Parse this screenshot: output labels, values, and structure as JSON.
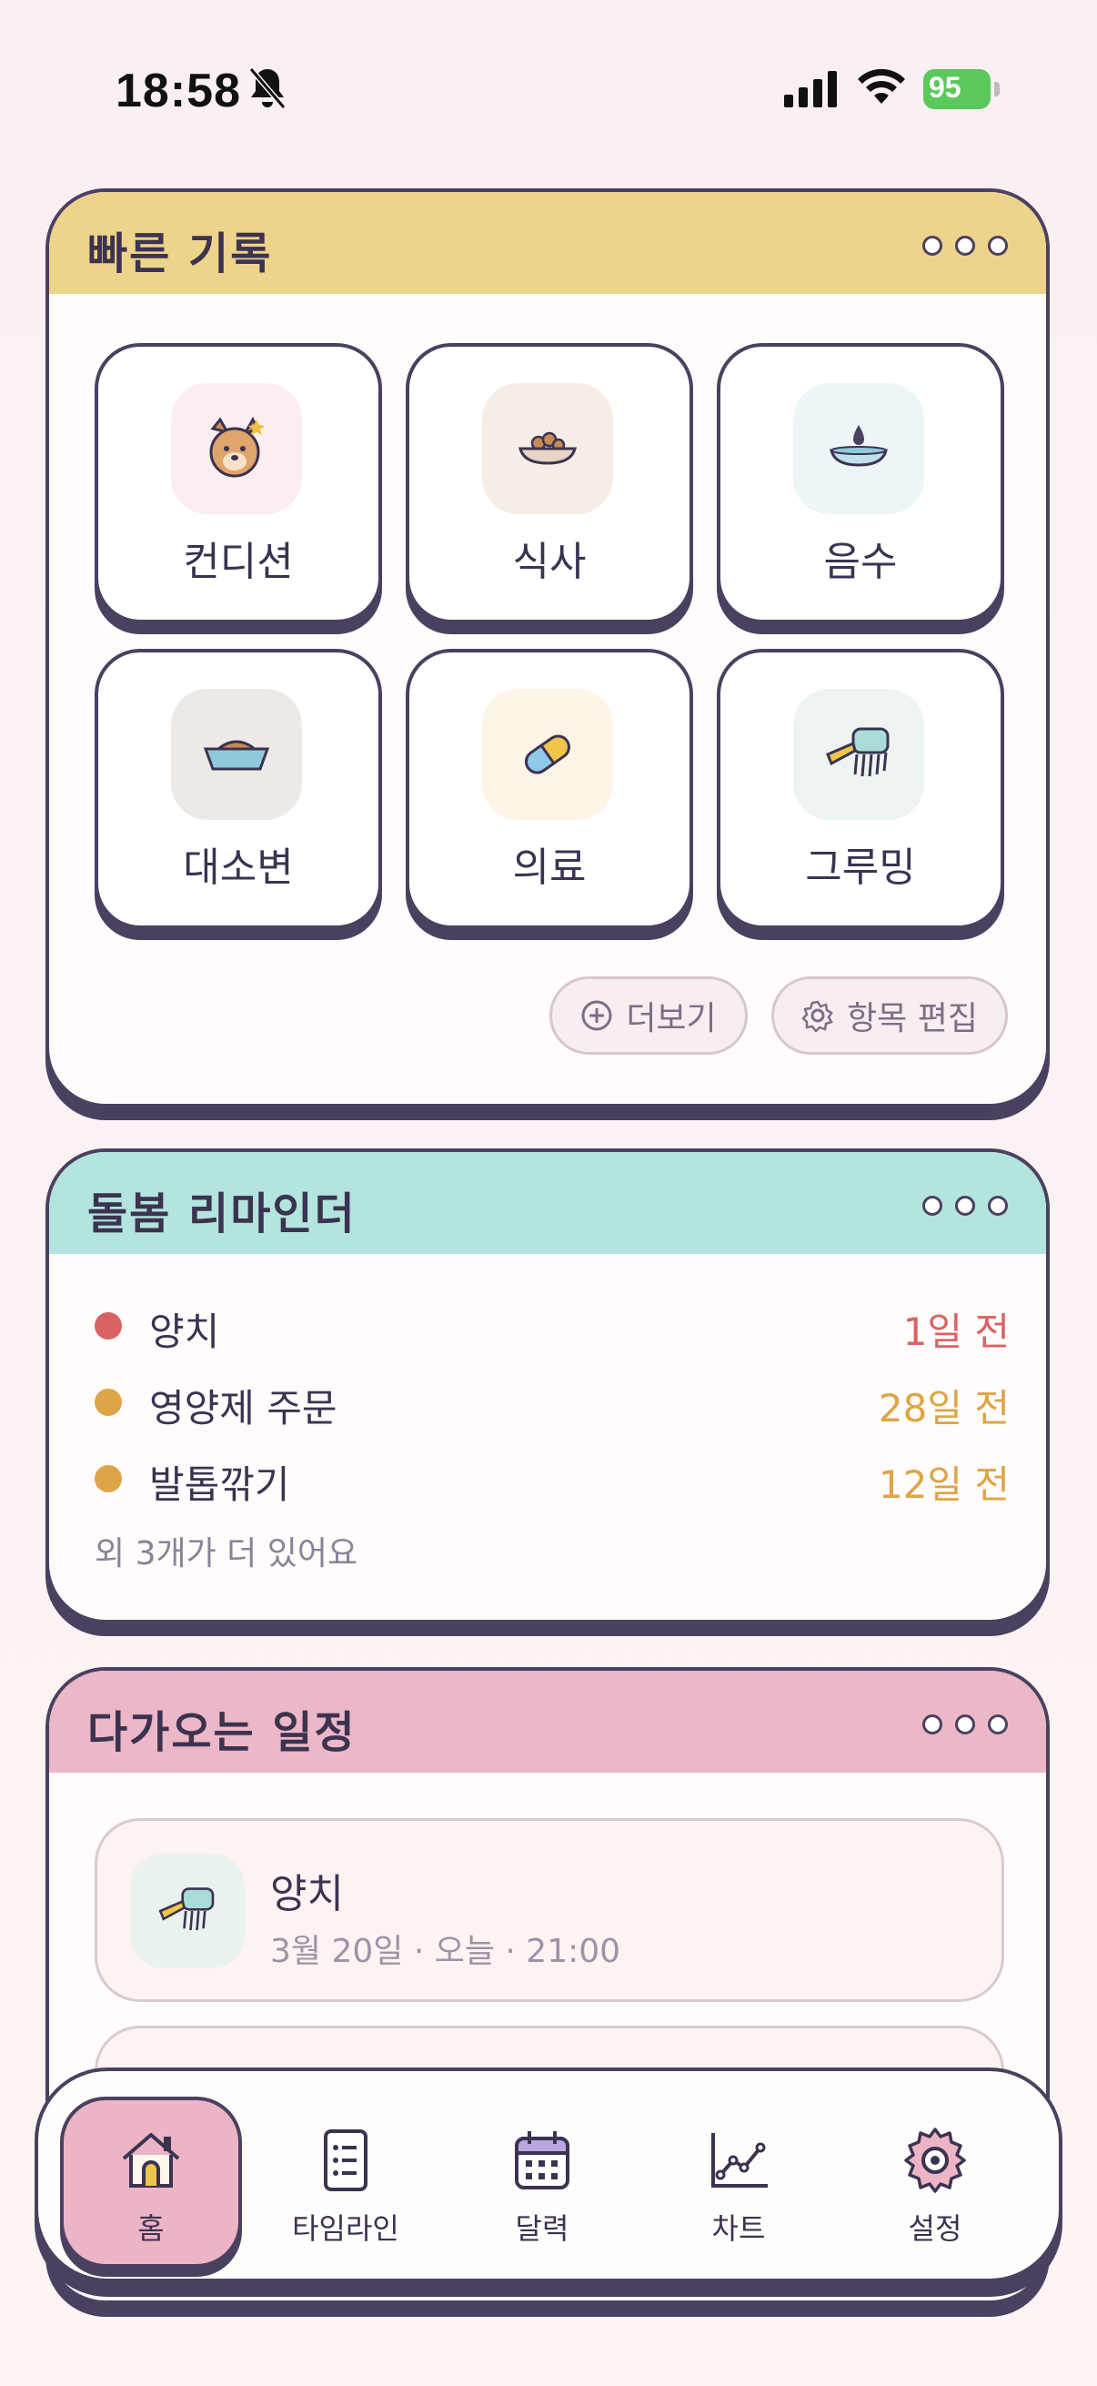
{
  "status_bar": {
    "time": "18:58",
    "battery": "95"
  },
  "quick_log": {
    "title": "빠른 기록",
    "tiles": [
      {
        "label": "컨디션",
        "icon": "dog-face-icon",
        "bg": "#fbeef0"
      },
      {
        "label": "식사",
        "icon": "food-bowl-icon",
        "bg": "#f6ede6"
      },
      {
        "label": "음수",
        "icon": "water-bowl-icon",
        "bg": "#eef5f6"
      },
      {
        "label": "대소변",
        "icon": "litter-box-icon",
        "bg": "#ede9e6"
      },
      {
        "label": "의료",
        "icon": "pill-icon",
        "bg": "#fcf4e6"
      },
      {
        "label": "그루밍",
        "icon": "brush-icon",
        "bg": "#eef4f1"
      }
    ],
    "more_label": "더보기",
    "edit_label": "항목 편집"
  },
  "reminders": {
    "title": "돌봄 리마인더",
    "items": [
      {
        "label": "양치",
        "when": "1일 전",
        "color": "#d96363"
      },
      {
        "label": "영양제 주문",
        "when": "28일 전",
        "color": "#dea446"
      },
      {
        "label": "발톱깎기",
        "when": "12일 전",
        "color": "#dea446"
      }
    ],
    "more_text": "외 3개가 더 있어요"
  },
  "schedule": {
    "title": "다가오는 일정",
    "items": [
      {
        "title": "양치",
        "subtitle": "3월 20일 · 오늘 · 21:00",
        "icon": "brush-icon"
      }
    ]
  },
  "nav": {
    "items": [
      {
        "label": "홈",
        "icon": "home-icon",
        "active": true
      },
      {
        "label": "타임라인",
        "icon": "list-icon",
        "active": false
      },
      {
        "label": "달력",
        "icon": "calendar-icon",
        "active": false
      },
      {
        "label": "차트",
        "icon": "chart-icon",
        "active": false
      },
      {
        "label": "설정",
        "icon": "gear-icon",
        "active": false
      }
    ]
  }
}
